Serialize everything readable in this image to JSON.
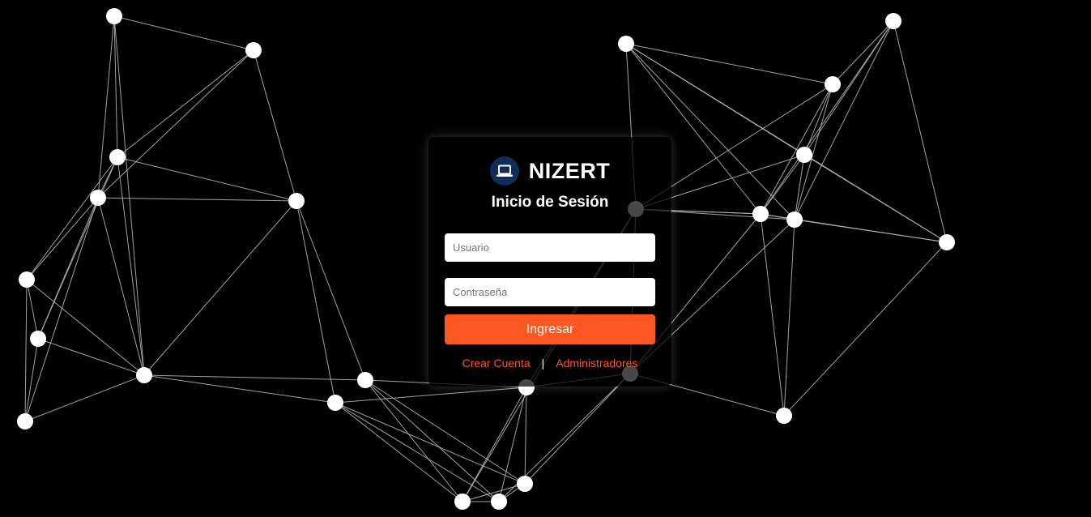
{
  "brand": {
    "name": "NIZERT",
    "icon": "laptop-icon"
  },
  "login": {
    "heading": "Inicio de Sesión",
    "username_placeholder": "Usuario",
    "username_value": "",
    "password_placeholder": "Contraseña",
    "password_value": "",
    "submit_label": "Ingresar"
  },
  "links": {
    "create_account": "Crear Cuenta",
    "separator": "|",
    "admins": "Administradores"
  },
  "colors": {
    "background": "#000000",
    "accent": "#ff5722",
    "brand_badge": "#0f2d56",
    "network_node": "#ffffff",
    "network_edge": "#bdbdbd"
  }
}
